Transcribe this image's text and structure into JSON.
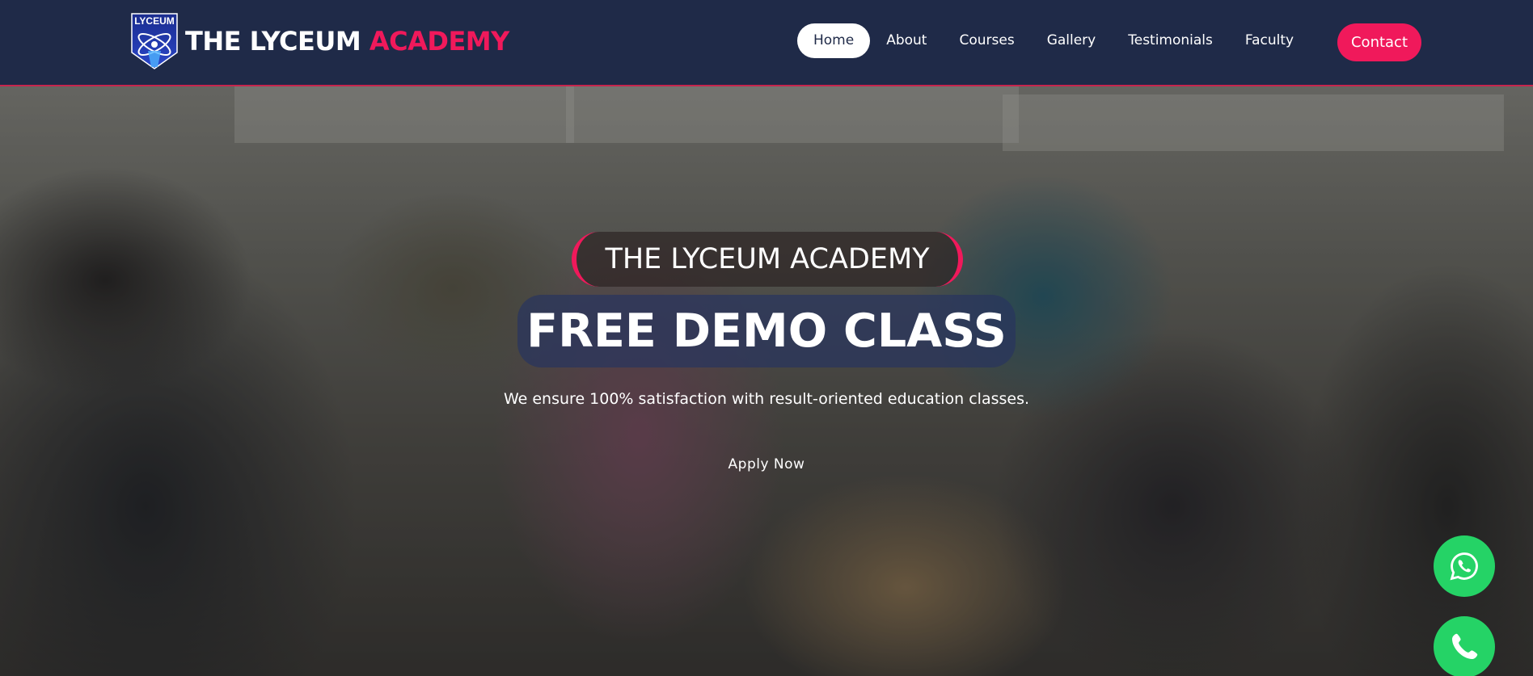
{
  "brand": {
    "logo_text": "LYCEUM",
    "title_main": "THE LYCEUM",
    "title_accent": "ACADEMY"
  },
  "nav": {
    "items": [
      {
        "label": "Home",
        "active": true
      },
      {
        "label": "About"
      },
      {
        "label": "Courses"
      },
      {
        "label": "Gallery"
      },
      {
        "label": "Testimonials"
      },
      {
        "label": "Faculty"
      }
    ],
    "contact_label": "Contact"
  },
  "hero": {
    "tagline": "THE LYCEUM ACADEMY",
    "headline": "FREE DEMO CLASS",
    "subtext": "We ensure 100% satisfaction with result-oriented education classes.",
    "cta_label": "Apply Now"
  },
  "floating": {
    "whatsapp_icon": "whatsapp-icon",
    "phone_icon": "phone-icon"
  },
  "colors": {
    "navbar_bg": "#1f2a48",
    "accent": "#f0195b",
    "whatsapp_green": "#25d366"
  }
}
